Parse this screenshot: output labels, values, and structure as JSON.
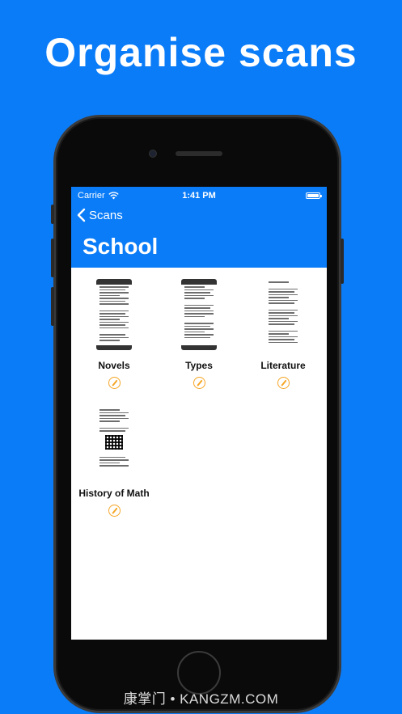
{
  "headline": "Organise scans",
  "status_bar": {
    "carrier": "Carrier",
    "time": "1:41 PM"
  },
  "nav": {
    "back_label": "Scans",
    "title": "School"
  },
  "documents": [
    {
      "label": "Novels",
      "edit_icon": "pencil-circle-icon"
    },
    {
      "label": "Types",
      "edit_icon": "pencil-circle-icon"
    },
    {
      "label": "Literature",
      "edit_icon": "pencil-circle-icon"
    },
    {
      "label": "History of Math",
      "edit_icon": "pencil-circle-icon"
    }
  ],
  "colors": {
    "brand_blue": "#0b7cf7",
    "edit_orange": "#f5a524"
  },
  "watermark": "康掌门 • KANGZM.COM"
}
